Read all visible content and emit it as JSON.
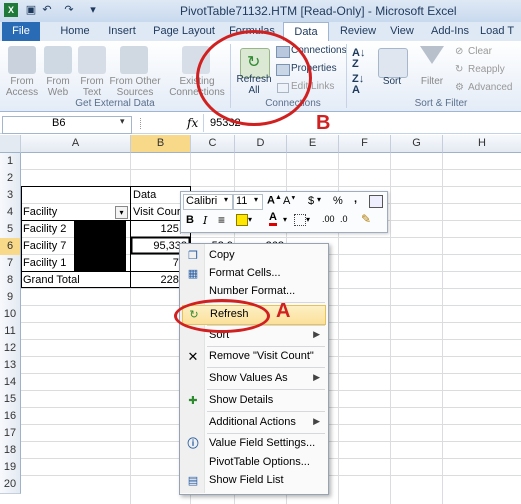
{
  "window": {
    "title": "PivotTable71132.HTM  [Read-Only]  -  Microsoft Excel"
  },
  "tabs": {
    "file": "File",
    "items": [
      "Home",
      "Insert",
      "Page Layout",
      "Formulas",
      "Data",
      "Review",
      "View",
      "Add-Ins",
      "Load T"
    ],
    "active": "Data"
  },
  "ribbon": {
    "external_data": {
      "from_access": "From\nAccess",
      "from_web": "From\nWeb",
      "from_text": "From\nText",
      "from_other": "From Other\nSources",
      "existing": "Existing\nConnections",
      "group_label": "Get External Data"
    },
    "connections": {
      "refresh_all": "Refresh\nAll",
      "connections": "Connections",
      "properties": "Properties",
      "edit_links": "Edit Links",
      "group_label": "Connections"
    },
    "sort_filter": {
      "sort": "Sort",
      "filter": "Filter",
      "clear": "Clear",
      "reapply": "Reapply",
      "advanced": "Advanced",
      "group_label": "Sort & Filter"
    }
  },
  "formula_bar": {
    "name_box": "B6",
    "fx": "fx",
    "value": "95332"
  },
  "sheet": {
    "columns": [
      "A",
      "B",
      "C",
      "D",
      "E",
      "F",
      "G",
      "H"
    ],
    "rows": [
      "1",
      "2",
      "3",
      "4",
      "5",
      "6",
      "7",
      "8",
      "9",
      "10",
      "11",
      "12",
      "13",
      "14",
      "15",
      "16",
      "17",
      "18",
      "19",
      "20"
    ],
    "cells": {
      "b3": "Data",
      "a4": "Facility",
      "b4": "Visit Cour",
      "a5": "Facility 2",
      "b5": "125,7",
      "a6": "Facility 7",
      "b6": "95,332",
      "c6": "53.9",
      "d6": "268",
      "a7": "Facility 1",
      "b7": "7,4",
      "a8": "Grand Total",
      "b8": "228,5"
    }
  },
  "mini_toolbar": {
    "font": "Calibri",
    "size": "11",
    "bold": "B",
    "italic": "I",
    "dollar": "$",
    "percent": "%",
    "comma": ","
  },
  "context_menu": {
    "items": [
      {
        "label": "Copy",
        "arrow": ""
      },
      {
        "label": "Format Cells...",
        "arrow": ""
      },
      {
        "label": "Number Format...",
        "arrow": ""
      },
      {
        "label": "Refresh",
        "arrow": ""
      },
      {
        "label": "Sort",
        "arrow": "▶"
      },
      {
        "label": "Remove \"Visit Count\"",
        "arrow": ""
      },
      {
        "label": "Show Values As",
        "arrow": "▶"
      },
      {
        "label": "Show Details",
        "arrow": ""
      },
      {
        "label": "Additional Actions",
        "arrow": "▶"
      },
      {
        "label": "Value Field Settings...",
        "arrow": ""
      },
      {
        "label": "PivotTable Options...",
        "arrow": ""
      },
      {
        "label": "Show Field List",
        "arrow": ""
      }
    ]
  },
  "annotations": {
    "a": "A",
    "b": "B"
  },
  "colors": {
    "accent": "#2a6bb5",
    "annotation": "#d12020",
    "selection": "#f8d98a"
  }
}
